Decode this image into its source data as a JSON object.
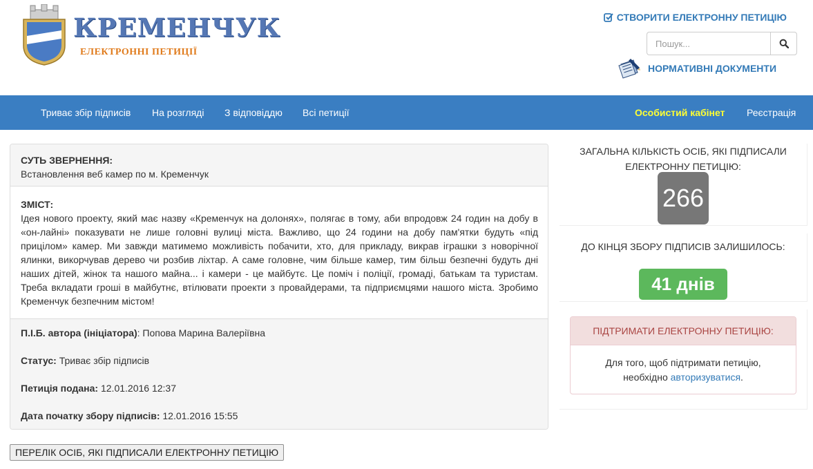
{
  "brand": {
    "title": "КРЕМЕНЧУК",
    "subtitle": "ЕЛЕКТРОННІ ПЕТИЦІЇ",
    "crest_colors": {
      "shield": "#4a7bc4",
      "band": "#ffffff",
      "gold": "#d8b45a"
    }
  },
  "header": {
    "create_label": "СТВОРИТИ ЕЛЕКТРОННУ ПЕТИЦІЮ",
    "search_placeholder": "Пошук...",
    "docs_label": "НОРМАТИВНІ ДОКУМЕНТИ"
  },
  "nav": {
    "items": [
      "Триває збір підписів",
      "На розгляді",
      "З відповіддю",
      "Всі петиції"
    ],
    "cabinet": "Особистий кабінет",
    "register": "Реєстрація"
  },
  "petition": {
    "subject_label": "СУТЬ ЗВЕРНЕННЯ:",
    "subject": "Встановлення веб камер по м. Кременчук",
    "content_label": "ЗМІСТ:",
    "content": "Ідея нового проекту, який має назву «Кременчук на долонях», полягає в тому, аби впродовж 24 годин на добу в «он-лайні» показувати не лише головні вулиці міста. Важливо, що 24 години на добу пам'ятки будуть «під прицілом» камер. Ми завжди матимемо можливість побачити, хто, для прикладу, викрав іграшки з новорічної ялинки, викорчував дерево чи розбив ліхтар. А саме головне, чим більше камер, тим більш безпечні будуть дні наших дітей, жінок та нашого майна... і камери - це майбутє. Це поміч і поліції, громаді, батькам та туристам. Треба вкладати гроші в майбутнє, втілювати проекти з провайдерами, та підприємцями нашого міста. Зробимо Кременчук безпечним містом!",
    "author_label": "П.І.Б. автора (ініціатора)",
    "author": ": Попова Марина Валеріївна",
    "status_label": "Статус:",
    "status": " Триває збір підписів",
    "submitted_label": "Петиція подана:",
    "submitted": " 12.01.2016 12:37",
    "start_label": "Дата початку збору підписів:",
    "start": " 12.01.2016 15:55",
    "list_button": "ПЕРЕЛІК ОСІБ, ЯКІ ПІДПИСАЛИ ЕЛЕКТРОННУ ПЕТИЦІЮ"
  },
  "stats": {
    "count_label_1": "ЗАГАЛЬНА КІЛЬКІСТЬ ОСІБ, ЯКІ ПІДПИСАЛИ",
    "count_label_2": "ЕЛЕКТРОННУ ПЕТИЦІЮ:",
    "count": "266",
    "days_label": "ДО КІНЦЯ ЗБОРУ ПІДПИСІВ ЗАЛИШИЛОСЬ:",
    "days": "41 днів"
  },
  "support": {
    "title": "ПІДТРИМАТИ ЕЛЕКТРОННУ ПЕТИЦІЮ:",
    "text_1": "Для того, щоб підтримати петицію,",
    "text_2": "необхідно ",
    "link": "авторизуватися",
    "text_3": "."
  },
  "colors": {
    "nav_bg": "#3a7ec2",
    "link": "#337ab7",
    "cabinet": "#ffff33",
    "count_badge": "#777777",
    "days_badge": "#5cb85c",
    "support_head_bg": "#f2dede",
    "support_head_text": "#a94442"
  },
  "icons": {
    "create": "edit-checkbox-icon",
    "search": "search-icon",
    "docs": "documents-icon"
  }
}
